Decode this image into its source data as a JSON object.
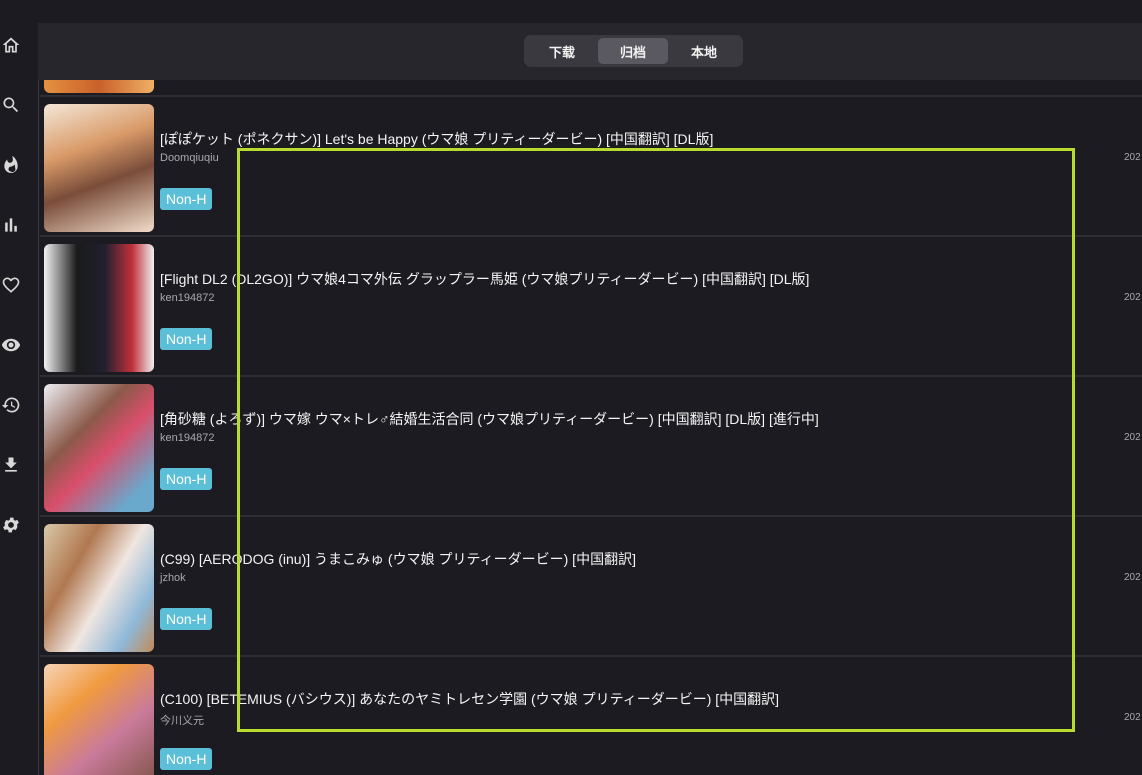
{
  "nav": [
    {
      "icon": "home-icon"
    },
    {
      "icon": "search-icon"
    },
    {
      "icon": "fire-icon"
    },
    {
      "icon": "bar-chart-icon"
    },
    {
      "icon": "heart-icon"
    },
    {
      "icon": "eye-icon"
    },
    {
      "icon": "history-icon"
    },
    {
      "icon": "download-icon"
    },
    {
      "icon": "gear-icon"
    }
  ],
  "tabs": [
    {
      "label": "下载",
      "active": false
    },
    {
      "label": "归档",
      "active": true
    },
    {
      "label": "本地",
      "active": false
    }
  ],
  "items": [
    {
      "title": "[ぽぽケット (ポネクサン)] Let's be Happy (ウマ娘 プリティーダービー) [中国翻訳] [DL版]",
      "uploader": "Doomqiuqiu",
      "date": "202",
      "tag": "Non-H"
    },
    {
      "title": "[Flight DL2 (DL2GO)] ウマ娘4コマ外伝 グラップラー馬姫 (ウマ娘プリティーダービー) [中国翻訳] [DL版]",
      "uploader": "ken194872",
      "date": "202",
      "tag": "Non-H"
    },
    {
      "title": "[角砂糖 (よろず)] ウマ嫁 ウマ×トレ♂結婚生活合同 (ウマ娘プリティーダービー) [中国翻訳] [DL版] [進行中]",
      "uploader": "ken194872",
      "date": "202",
      "tag": "Non-H"
    },
    {
      "title": "(C99) [AERODOG (inu)] うまこみゅ (ウマ娘 プリティーダービー) [中国翻訳]",
      "uploader": "jzhok",
      "date": "202",
      "tag": "Non-H"
    },
    {
      "title": "(C100) [BETEMIUS (バシウス)] あなたのヤミトレセン学園 (ウマ娘 プリティーダービー) [中国翻訳]",
      "uploader": "今川义元",
      "date": "202",
      "tag": "Non-H"
    }
  ],
  "colors": {
    "background": "#1c1b21",
    "topbar": "#27262c",
    "tag": "#5bbfd7",
    "highlight_box": "#b8dc2e"
  }
}
